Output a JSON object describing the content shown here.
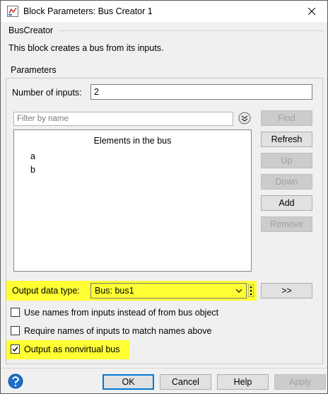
{
  "window": {
    "title": "Block Parameters: Bus Creator 1",
    "title_icon": "matlab-block-icon",
    "close_icon": "close-icon"
  },
  "block": {
    "group_label": "BusCreator",
    "description": "This block creates a bus from its inputs."
  },
  "parameters": {
    "group_label": "Parameters",
    "num_inputs_label": "Number of inputs:",
    "num_inputs_value": "2",
    "filter_placeholder": "Filter by name",
    "list_header": "Elements in the bus",
    "elements": [
      "a",
      "b"
    ],
    "buttons": {
      "find": "Find",
      "refresh": "Refresh",
      "up": "Up",
      "down": "Down",
      "add": "Add",
      "remove": "Remove"
    },
    "output_type_label": "Output data type:",
    "output_type_value": "Bus: bus1",
    "assistant_button": ">>",
    "checkboxes": [
      {
        "label": "Use names from inputs instead of from bus object",
        "checked": false
      },
      {
        "label": "Require names of inputs to match names above",
        "checked": false
      },
      {
        "label": "Output as nonvirtual bus",
        "checked": true
      }
    ]
  },
  "footer": {
    "ok": "OK",
    "cancel": "Cancel",
    "help": "Help",
    "apply": "Apply",
    "help_icon": "help-icon"
  },
  "colors": {
    "highlight": "#ffff33",
    "focus_border": "#0078d7",
    "help_icon_blue": "#1e6fc8"
  }
}
